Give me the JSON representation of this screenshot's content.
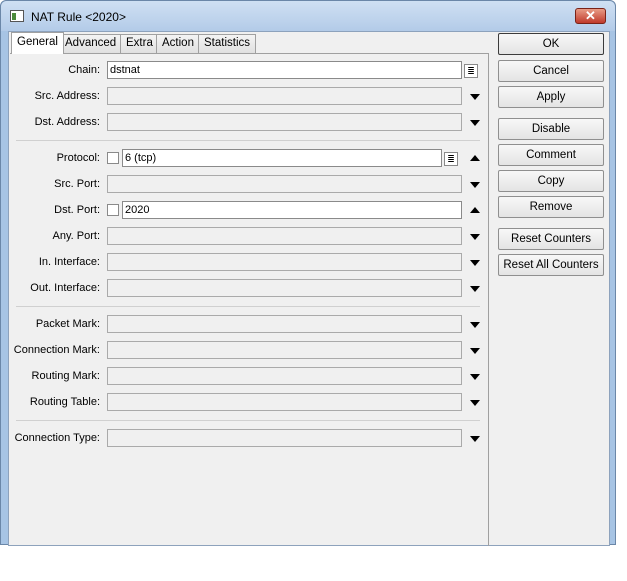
{
  "window": {
    "title": "NAT Rule <2020>",
    "close_label": "✕"
  },
  "tabs": [
    "General",
    "Advanced",
    "Extra",
    "Action",
    "Statistics"
  ],
  "fields": {
    "chain": {
      "label": "Chain:",
      "value": "dstnat"
    },
    "src_address": {
      "label": "Src. Address:"
    },
    "dst_address": {
      "label": "Dst. Address:"
    },
    "protocol": {
      "label": "Protocol:",
      "value": "6 (tcp)"
    },
    "src_port": {
      "label": "Src. Port:"
    },
    "dst_port": {
      "label": "Dst. Port:",
      "value": "2020"
    },
    "any_port": {
      "label": "Any. Port:"
    },
    "in_interface": {
      "label": "In. Interface:"
    },
    "out_interface": {
      "label": "Out. Interface:"
    },
    "packet_mark": {
      "label": "Packet Mark:"
    },
    "connection_mark": {
      "label": "Connection Mark:"
    },
    "routing_mark": {
      "label": "Routing Mark:"
    },
    "routing_table": {
      "label": "Routing Table:"
    },
    "connection_type": {
      "label": "Connection Type:"
    }
  },
  "buttons": {
    "ok": "OK",
    "cancel": "Cancel",
    "apply": "Apply",
    "disable": "Disable",
    "comment": "Comment",
    "copy": "Copy",
    "remove": "Remove",
    "reset_counters": "Reset Counters",
    "reset_all_counters": "Reset All Counters"
  },
  "icons": {
    "dropdown": "▼",
    "expand": "▲",
    "combo": "≣"
  }
}
